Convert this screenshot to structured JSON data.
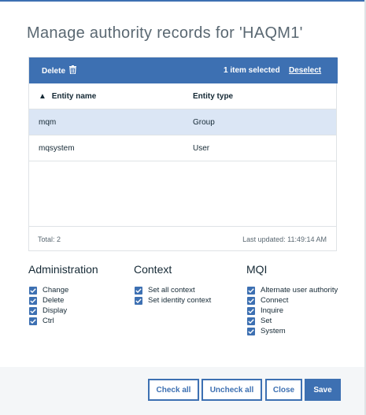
{
  "dialog": {
    "title": "Manage authority records for 'HAQM1'"
  },
  "toolbar": {
    "delete_label": "Delete",
    "selected_text": "1 item selected",
    "deselect_label": "Deselect"
  },
  "table": {
    "columns": [
      "Entity name",
      "Entity type"
    ],
    "rows": [
      {
        "name": "mqm",
        "type": "Group",
        "selected": true
      },
      {
        "name": "mqsystem",
        "type": "User",
        "selected": false
      }
    ],
    "footer_total": "Total: 2",
    "footer_updated": "Last updated: 11:49:14 AM"
  },
  "sections": {
    "administration": {
      "title": "Administration",
      "items": [
        "Change",
        "Delete",
        "Display",
        "Ctrl"
      ]
    },
    "context": {
      "title": "Context",
      "items": [
        "Set all context",
        "Set identity context"
      ]
    },
    "mqi": {
      "title": "MQI",
      "items": [
        "Alternate user authority",
        "Connect",
        "Inquire",
        "Set",
        "System"
      ]
    }
  },
  "buttons": {
    "check_all": "Check all",
    "uncheck_all": "Uncheck all",
    "close": "Close",
    "save": "Save"
  },
  "colors": {
    "accent": "#3d70b2",
    "selected_row": "#dbe6f5",
    "footer_bg": "#f4f6f8"
  },
  "icons": {
    "delete": "trash-icon",
    "sort": "sort-up-icon",
    "checkbox": "checkmark-icon"
  }
}
